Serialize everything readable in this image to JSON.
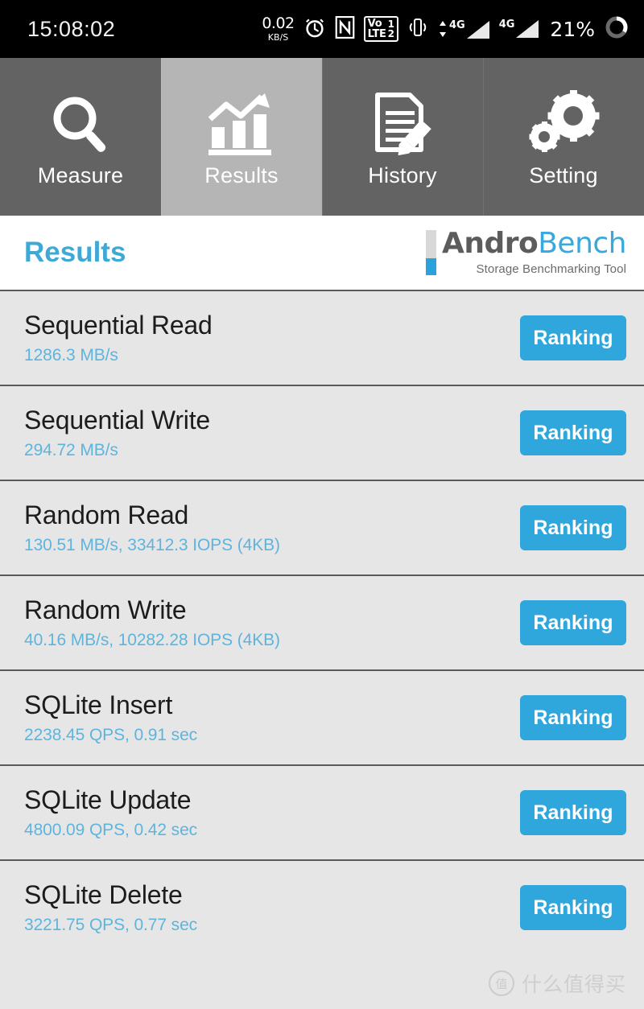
{
  "statusbar": {
    "time": "15:08:02",
    "data_rate_value": "0.02",
    "data_rate_unit": "KB/S",
    "alarm_icon": "alarm-clock-icon",
    "nfc_icon": "nfc-icon",
    "volte_label_top": "Vo",
    "volte_label_bottom": "LTE",
    "volte_sim_top": "1",
    "volte_sim_bottom": "2",
    "vibrate_icon": "vibrate-icon",
    "signal1_label": "4G",
    "signal2_label": "4G",
    "battery_percent": "21%",
    "battery_icon": "battery-circle-icon"
  },
  "tabs": [
    {
      "label": "Measure",
      "icon": "magnifier-icon",
      "active": false
    },
    {
      "label": "Results",
      "icon": "bar-chart-arrow-icon",
      "active": true
    },
    {
      "label": "History",
      "icon": "document-pencil-icon",
      "active": false
    },
    {
      "label": "Setting",
      "icon": "gears-icon",
      "active": false
    }
  ],
  "header": {
    "title": "Results",
    "logo_primary": "Andro",
    "logo_secondary": "Bench",
    "logo_subtitle": "Storage Benchmarking Tool"
  },
  "results": [
    {
      "name": "Sequential Read",
      "value": "1286.3 MB/s",
      "button": "Ranking"
    },
    {
      "name": "Sequential Write",
      "value": "294.72 MB/s",
      "button": "Ranking"
    },
    {
      "name": "Random Read",
      "value": "130.51 MB/s, 33412.3 IOPS (4KB)",
      "button": "Ranking"
    },
    {
      "name": "Random Write",
      "value": "40.16 MB/s, 10282.28 IOPS (4KB)",
      "button": "Ranking"
    },
    {
      "name": "SQLite Insert",
      "value": "2238.45 QPS, 0.91 sec",
      "button": "Ranking"
    },
    {
      "name": "SQLite Update",
      "value": "4800.09 QPS, 0.42 sec",
      "button": "Ranking"
    },
    {
      "name": "SQLite Delete",
      "value": "3221.75 QPS, 0.77 sec",
      "button": "Ranking"
    }
  ],
  "watermark": {
    "badge": "值",
    "text": "什么值得买"
  },
  "colors": {
    "accent_blue": "#2fa7dd",
    "title_blue": "#3fa9d6",
    "value_blue": "#5fb4dd",
    "tab_inactive": "#636363",
    "tab_active": "#b5b5b5",
    "list_bg": "#e6e6e6",
    "row_divider": "#555a5a"
  }
}
